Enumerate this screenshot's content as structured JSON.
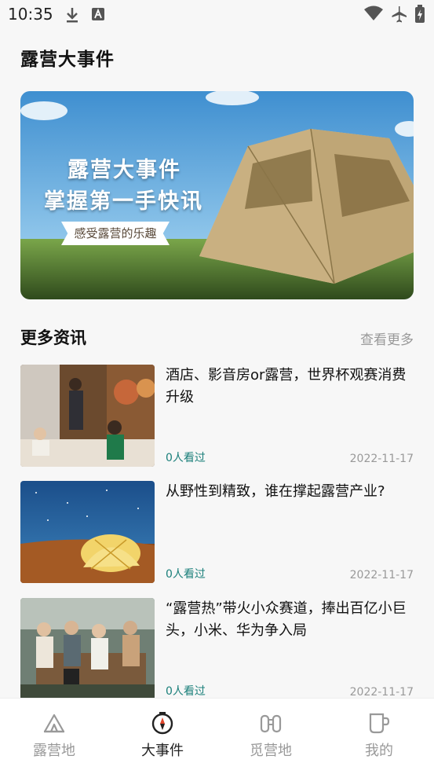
{
  "status_bar": {
    "time": "10:35"
  },
  "page": {
    "title": "露营大事件"
  },
  "banner": {
    "line1": "露营大事件",
    "line2": "掌握第一手快讯",
    "tag": "感受露营的乐趣"
  },
  "news_section": {
    "title": "更多资讯",
    "more_label": "查看更多",
    "items": [
      {
        "title": "酒店、影音房or露营，世界杯观赛消费升级",
        "views": "0人看过",
        "date": "2022-11-17"
      },
      {
        "title": "从野性到精致，谁在撑起露营产业?",
        "views": "0人看过",
        "date": "2022-11-17"
      },
      {
        "title": "“露营热”带火小众赛道，捧出百亿小巨头，小米、华为争入局",
        "views": "0人看过",
        "date": "2022-11-17"
      }
    ]
  },
  "tabs": [
    {
      "label": "露营地",
      "icon": "tent-icon"
    },
    {
      "label": "大事件",
      "icon": "compass-icon",
      "active": true
    },
    {
      "label": "觅营地",
      "icon": "binoculars-icon"
    },
    {
      "label": "我的",
      "icon": "cup-icon"
    }
  ],
  "colors": {
    "accent": "#1a7f7a",
    "muted": "#999999"
  }
}
